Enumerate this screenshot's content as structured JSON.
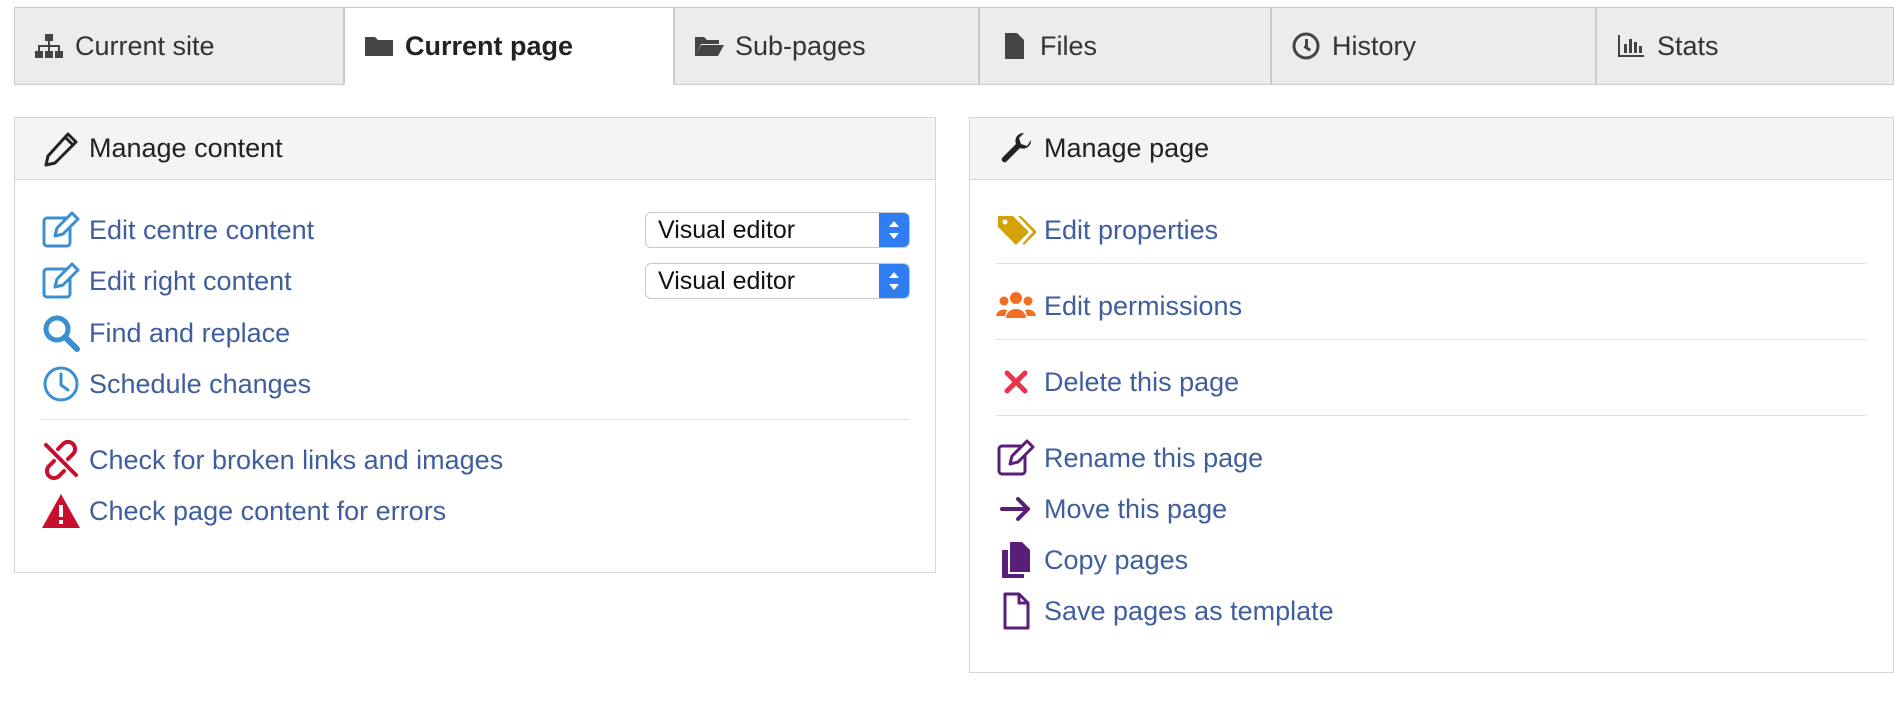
{
  "tabs": [
    {
      "label": "Current site",
      "icon": "sitemap-icon"
    },
    {
      "label": "Current page",
      "icon": "folder-icon",
      "active": true
    },
    {
      "label": "Sub-pages",
      "icon": "folder-open-icon"
    },
    {
      "label": "Files",
      "icon": "file-icon"
    },
    {
      "label": "History",
      "icon": "clock-icon"
    },
    {
      "label": "Stats",
      "icon": "bar-chart-icon"
    }
  ],
  "manage_content": {
    "title": "Manage content",
    "items": [
      {
        "label": "Edit centre content",
        "icon": "edit-icon",
        "editor": "Visual editor"
      },
      {
        "label": "Edit right content",
        "icon": "edit-icon",
        "editor": "Visual editor"
      },
      {
        "label": "Find and replace",
        "icon": "search-icon"
      },
      {
        "label": "Schedule changes",
        "icon": "clock-icon"
      },
      {
        "label": "Check for broken links and images",
        "icon": "unlink-icon"
      },
      {
        "label": "Check page content for errors",
        "icon": "warning-icon"
      }
    ]
  },
  "manage_page": {
    "title": "Manage page",
    "items": [
      {
        "label": "Edit properties",
        "icon": "tags-icon"
      },
      {
        "label": "Edit permissions",
        "icon": "users-icon"
      },
      {
        "label": "Delete this page",
        "icon": "close-icon"
      },
      {
        "label": "Rename this page",
        "icon": "edit-icon"
      },
      {
        "label": "Move this page",
        "icon": "arrow-right-icon"
      },
      {
        "label": "Copy pages",
        "icon": "copy-icon"
      },
      {
        "label": "Save pages as template",
        "icon": "file-outline-icon"
      }
    ]
  },
  "colors": {
    "link": "#3f5e9e",
    "edit_blue": "#3a8fd1",
    "danger_red": "#c8102e",
    "tags_gold": "#d4a10b",
    "users_orange": "#f26f21",
    "delete_pink": "#e8334a",
    "purple": "#5a1e78",
    "select_blue": "#2f7ef1"
  }
}
